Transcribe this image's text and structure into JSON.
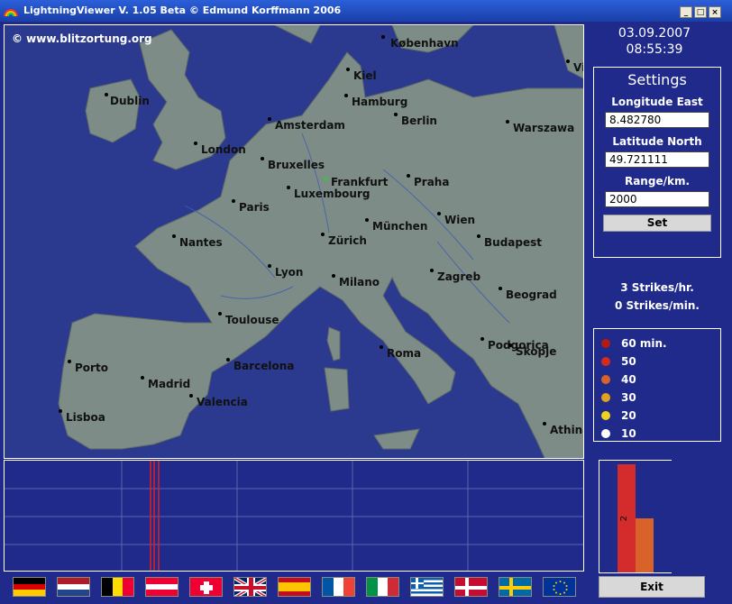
{
  "window": {
    "title": "LightningViewer V. 1.05 Beta © Edmund Korffmann 2006",
    "controls": [
      "_",
      "□",
      "×"
    ]
  },
  "map": {
    "copyright": "© www.blitzortung.org",
    "cities": [
      {
        "name": "København"
      },
      {
        "name": "Kiel"
      },
      {
        "name": "Hamburg"
      },
      {
        "name": "Dublin"
      },
      {
        "name": "Amsterdam"
      },
      {
        "name": "Berlin"
      },
      {
        "name": "Warszawa"
      },
      {
        "name": "London"
      },
      {
        "name": "Bruxelles"
      },
      {
        "name": "Frankfurt"
      },
      {
        "name": "Luxembourg"
      },
      {
        "name": "Praha"
      },
      {
        "name": "Paris"
      },
      {
        "name": "München"
      },
      {
        "name": "Wien"
      },
      {
        "name": "Nantes"
      },
      {
        "name": "Zürich"
      },
      {
        "name": "Budapest"
      },
      {
        "name": "Lyon"
      },
      {
        "name": "Milano"
      },
      {
        "name": "Zagreb"
      },
      {
        "name": "Beograd"
      },
      {
        "name": "Toulouse"
      },
      {
        "name": "Podgorica"
      },
      {
        "name": "Skopje"
      },
      {
        "name": "Roma"
      },
      {
        "name": "Porto"
      },
      {
        "name": "Barcelona"
      },
      {
        "name": "Madrid"
      },
      {
        "name": "Valencia"
      },
      {
        "name": "Lisboa"
      },
      {
        "name": "Athina"
      },
      {
        "name": "Vi"
      }
    ]
  },
  "datetime": {
    "date": "03.09.2007",
    "time": "08:55:39"
  },
  "settings": {
    "heading": "Settings",
    "longitude_label": "Longitude East",
    "longitude_value": "8.482780",
    "latitude_label": "Latitude North",
    "latitude_value": "49.721111",
    "range_label": "Range/km.",
    "range_value": "2000",
    "set_label": "Set"
  },
  "strikes": {
    "per_hour": "3 Strikes/hr.",
    "per_min": "0 Strikes/min."
  },
  "legend": [
    {
      "label": "60 min.",
      "color": "#b21a12"
    },
    {
      "label": "50",
      "color": "#d42c1c"
    },
    {
      "label": "40",
      "color": "#d9612a"
    },
    {
      "label": "30",
      "color": "#e0a21e"
    },
    {
      "label": "20",
      "color": "#f0d020"
    },
    {
      "label": "10",
      "color": "#ffffff"
    }
  ],
  "histogram": {
    "bars": [
      {
        "value": 2,
        "label": "2",
        "color": "#d42c2c"
      },
      {
        "value": 1,
        "color": "#d9612a"
      }
    ]
  },
  "exit_label": "Exit",
  "flags": [
    "Germany",
    "Netherlands",
    "Belgium",
    "Austria",
    "Switzerland",
    "United Kingdom",
    "Spain",
    "France",
    "Italy",
    "Greece",
    "Denmark",
    "Sweden",
    "European Union"
  ]
}
